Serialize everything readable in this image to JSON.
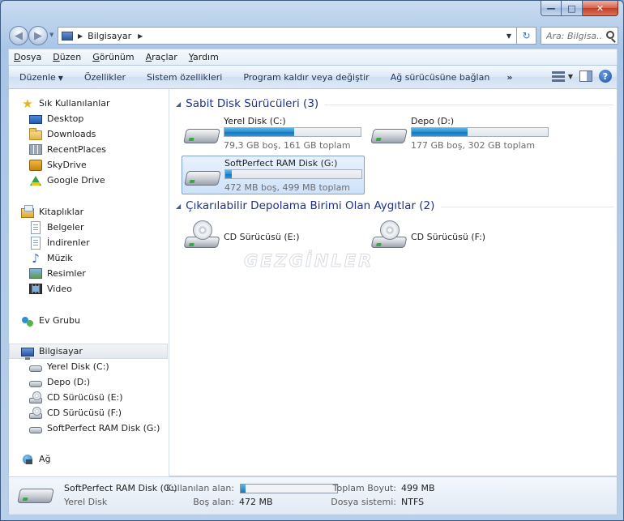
{
  "window": {
    "caption": {
      "minimize": "—",
      "maximize": "□",
      "close": "✕"
    }
  },
  "address": {
    "crumbs": [
      "Bilgisayar"
    ],
    "search_placeholder": "Ara: Bilgisa...",
    "back_icon": "back-arrow-icon",
    "forward_icon": "forward-arrow-icon"
  },
  "menubar": {
    "items": [
      "Dosya",
      "Düzen",
      "Görünüm",
      "Araçlar",
      "Yardım"
    ]
  },
  "commandbar": {
    "items": [
      "Düzenle",
      "Özellikler",
      "Sistem özellikleri",
      "Program kaldır veya değiştir",
      "Ağ sürücüsüne bağlan"
    ],
    "more": "»"
  },
  "nav": {
    "favorites": {
      "title": "Sık Kullanılanlar",
      "items": [
        "Desktop",
        "Downloads",
        "RecentPlaces",
        "SkyDrive",
        "Google Drive"
      ]
    },
    "libraries": {
      "title": "Kitaplıklar",
      "items": [
        "Belgeler",
        "İndirenler",
        "Müzik",
        "Resimler",
        "Video"
      ]
    },
    "homegroup": "Ev Grubu",
    "computer": {
      "title": "Bilgisayar",
      "items": [
        "Yerel Disk (C:)",
        "Depo (D:)",
        "CD Sürücüsü (E:)",
        "CD Sürücüsü (F:)",
        "SoftPerfect RAM Disk (G:)"
      ]
    },
    "network": "Ağ"
  },
  "main": {
    "hard_disks": {
      "title": "Sabit Disk Sürücüleri (3)",
      "drives": [
        {
          "name": "Yerel Disk (C:)",
          "info": "79,3 GB boş, 161 GB toplam",
          "used_fraction": 0.51
        },
        {
          "name": "Depo (D:)",
          "info": "177 GB boş, 302 GB toplam",
          "used_fraction": 0.41
        },
        {
          "name": "SoftPerfect RAM Disk (G:)",
          "info": "472 MB boş, 499 MB toplam",
          "used_fraction": 0.05
        }
      ]
    },
    "removable": {
      "title": "Çıkarılabilir Depolama Birimi Olan Aygıtlar (2)",
      "drives": [
        {
          "name": "CD Sürücüsü (E:)"
        },
        {
          "name": "CD Sürücüsü (F:)"
        }
      ]
    },
    "watermark": "GEZGİNLER"
  },
  "details": {
    "name": "SoftPerfect RAM Disk (G:)",
    "type": "Yerel Disk",
    "used_label": "Kullanılan alan:",
    "used_fraction": 0.05,
    "free_label": "Boş alan:",
    "free_value": "472 MB",
    "total_label": "Toplam Boyut:",
    "total_value": "499 MB",
    "fs_label": "Dosya sistemi:",
    "fs_value": "NTFS"
  },
  "colors": {
    "group_title": "#1e3287",
    "bar_fill": "#2a8ccf",
    "selection": "#cde2fa"
  }
}
